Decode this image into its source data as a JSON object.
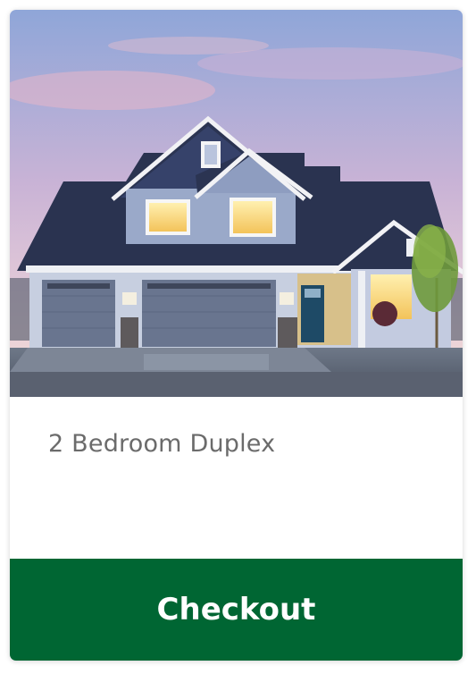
{
  "product": {
    "title": "2 Bedroom Duplex",
    "image_icon": "house-photo",
    "checkout_label": "Checkout"
  },
  "colors": {
    "button_bg": "#006633",
    "button_text": "#ffffff",
    "title_text": "#6b6b6b"
  }
}
